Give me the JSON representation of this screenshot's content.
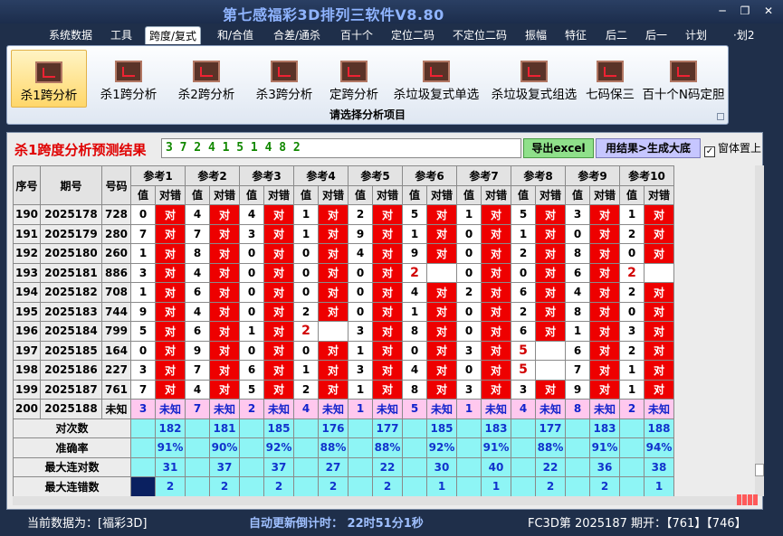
{
  "window": {
    "title": "第七感福彩3D排列三软件V8.80",
    "min": "─",
    "max": "❐",
    "close": "✕"
  },
  "menu": [
    "系统数据",
    "工具",
    "跨度/复式",
    "和/合值",
    "合差/通杀",
    "百十个",
    "定位二码",
    "不定位二码",
    "振幅",
    "特征",
    "后二",
    "后一",
    "计划",
    "·划2"
  ],
  "ribbon": {
    "buttons": [
      "杀1跨分析",
      "杀1跨分析",
      "杀2跨分析",
      "杀3跨分析",
      "定跨分析",
      "杀垃圾复式单选",
      "杀垃圾复式组选",
      "七码保三",
      "百十个N码定胆"
    ],
    "caption": "请选择分析项目",
    "icon": "chart-icon"
  },
  "toolbar": {
    "label": "杀1跨度分析预测结果",
    "result": "3 7 2 4 1 5 1 4 8 2",
    "export": "导出excel",
    "generate": "用结果>生成大底",
    "topmost": "窗体置上",
    "check": "✓"
  },
  "table": {
    "headers": {
      "seq": "序号",
      "issue": "期号",
      "code": "号码",
      "value": "值",
      "check": "对错"
    },
    "refs": [
      "参考1",
      "参考2",
      "参考3",
      "参考4",
      "参考5",
      "参考6",
      "参考7",
      "参考8",
      "参考9",
      "参考10"
    ],
    "rows": [
      {
        "seq": "190",
        "issue": "2025178",
        "code": "728",
        "v": [
          "0",
          "4",
          "4",
          "1",
          "2",
          "5",
          "1",
          "5",
          "3",
          "1"
        ],
        "c": [
          "对",
          "对",
          "对",
          "对",
          "对",
          "对",
          "对",
          "对",
          "对",
          "对"
        ]
      },
      {
        "seq": "191",
        "issue": "2025179",
        "code": "280",
        "v": [
          "7",
          "7",
          "3",
          "1",
          "9",
          "1",
          "0",
          "1",
          "0",
          "2"
        ],
        "c": [
          "对",
          "对",
          "对",
          "对",
          "对",
          "对",
          "对",
          "对",
          "对",
          "对"
        ]
      },
      {
        "seq": "192",
        "issue": "2025180",
        "code": "260",
        "v": [
          "1",
          "8",
          "0",
          "0",
          "4",
          "9",
          "0",
          "2",
          "8",
          "0"
        ],
        "c": [
          "对",
          "对",
          "对",
          "对",
          "对",
          "对",
          "对",
          "对",
          "对",
          "对"
        ]
      },
      {
        "seq": "193",
        "issue": "2025181",
        "code": "886",
        "v": [
          "3",
          "4",
          "0",
          "0",
          "0",
          "2",
          "0",
          "0",
          "6",
          "2"
        ],
        "c": [
          "对",
          "对",
          "对",
          "对",
          "对",
          "",
          "对",
          "对",
          "对",
          ""
        ]
      },
      {
        "seq": "194",
        "issue": "2025182",
        "code": "708",
        "v": [
          "1",
          "6",
          "0",
          "0",
          "0",
          "4",
          "2",
          "6",
          "4",
          "2"
        ],
        "c": [
          "对",
          "对",
          "对",
          "对",
          "对",
          "对",
          "对",
          "对",
          "对",
          "对"
        ]
      },
      {
        "seq": "195",
        "issue": "2025183",
        "code": "744",
        "v": [
          "9",
          "4",
          "0",
          "2",
          "0",
          "1",
          "0",
          "2",
          "8",
          "0"
        ],
        "c": [
          "对",
          "对",
          "对",
          "对",
          "对",
          "对",
          "对",
          "对",
          "对",
          "对"
        ]
      },
      {
        "seq": "196",
        "issue": "2025184",
        "code": "799",
        "v": [
          "5",
          "6",
          "1",
          "2",
          "3",
          "8",
          "0",
          "6",
          "1",
          "3"
        ],
        "c": [
          "对",
          "对",
          "对",
          "",
          "对",
          "对",
          "对",
          "对",
          "对",
          "对"
        ]
      },
      {
        "seq": "197",
        "issue": "2025185",
        "code": "164",
        "v": [
          "0",
          "9",
          "0",
          "0",
          "1",
          "0",
          "3",
          "5",
          "6",
          "2"
        ],
        "c": [
          "对",
          "对",
          "对",
          "对",
          "对",
          "对",
          "对",
          "",
          "对",
          "对"
        ]
      },
      {
        "seq": "198",
        "issue": "2025186",
        "code": "227",
        "v": [
          "3",
          "7",
          "6",
          "1",
          "3",
          "4",
          "0",
          "5",
          "7",
          "1"
        ],
        "c": [
          "对",
          "对",
          "对",
          "对",
          "对",
          "对",
          "对",
          "",
          "对",
          "对"
        ]
      },
      {
        "seq": "199",
        "issue": "2025187",
        "code": "761",
        "v": [
          "7",
          "4",
          "5",
          "2",
          "1",
          "8",
          "3",
          "3",
          "9",
          "1"
        ],
        "c": [
          "对",
          "对",
          "对",
          "对",
          "对",
          "对",
          "对",
          "对",
          "对",
          "对"
        ]
      },
      {
        "seq": "200",
        "issue": "2025188",
        "code": "未知",
        "v": [
          "3",
          "7",
          "2",
          "4",
          "1",
          "5",
          "1",
          "4",
          "8",
          "2"
        ],
        "c": [
          "未知",
          "未知",
          "未知",
          "未知",
          "未知",
          "未知",
          "未知",
          "未知",
          "未知",
          "未知"
        ]
      }
    ],
    "red_values": [
      [
        3,
        5
      ],
      [
        3,
        9
      ],
      [
        6,
        3
      ],
      [
        7,
        7
      ],
      [
        8,
        7
      ]
    ],
    "stats": [
      {
        "label": "对次数",
        "values": [
          "182",
          "181",
          "185",
          "176",
          "177",
          "185",
          "183",
          "177",
          "183",
          "188"
        ]
      },
      {
        "label": "准确率",
        "values": [
          "91%",
          "90%",
          "92%",
          "88%",
          "88%",
          "92%",
          "91%",
          "88%",
          "91%",
          "94%"
        ]
      },
      {
        "label": "最大连对数",
        "values": [
          "31",
          "37",
          "37",
          "27",
          "22",
          "30",
          "40",
          "22",
          "36",
          "38"
        ]
      },
      {
        "label": "最大连错数",
        "values": [
          "2",
          "2",
          "2",
          "2",
          "2",
          "1",
          "1",
          "2",
          "2",
          "1"
        ]
      }
    ]
  },
  "status": {
    "current": "当前数据为：[福彩3D]",
    "countdown": "自动更新倒计时：  22时51分1秒",
    "issue": "FC3D第 2025187 期开：【761】【746】"
  },
  "colors": {
    "hit": "#ee0000",
    "unknown": "#ffc8ee",
    "stat": "#8ef5f5",
    "red_value": "#d10000"
  }
}
